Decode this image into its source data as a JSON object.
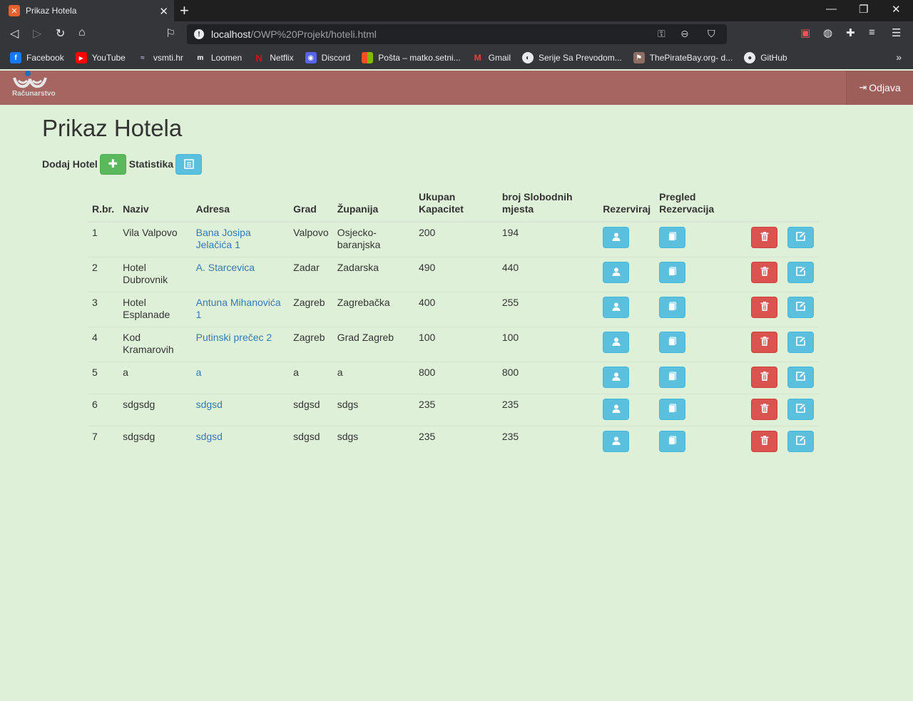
{
  "browser": {
    "tab_title": "Prikaz Hotela",
    "url_host": "localhost",
    "url_path": "/OWP%20Projekt/hoteli.html",
    "bookmarks": [
      {
        "label": "Facebook",
        "color": "#1877f2",
        "glyph": "f"
      },
      {
        "label": "YouTube",
        "color": "#ff0000",
        "glyph": "▶"
      },
      {
        "label": "vsmti.hr",
        "color": "#35363a",
        "glyph": "≈"
      },
      {
        "label": "Loomen",
        "color": "#35363a",
        "glyph": "m"
      },
      {
        "label": "Netflix",
        "color": "#35363a",
        "glyph": "N"
      },
      {
        "label": "Discord",
        "color": "#5865f2",
        "glyph": "◉"
      },
      {
        "label": "Pošta – matko.setni...",
        "color": "#f25022",
        "glyph": "▦"
      },
      {
        "label": "Gmail",
        "color": "#35363a",
        "glyph": "M"
      },
      {
        "label": "Serije Sa Prevodom...",
        "color": "#5f6368",
        "glyph": "◐"
      },
      {
        "label": "ThePirateBay.org- d...",
        "color": "#8d6e63",
        "glyph": "⚑"
      },
      {
        "label": "GitHub",
        "color": "#35363a",
        "glyph": "●"
      }
    ]
  },
  "header": {
    "logo_text": "Računarstvo",
    "logout_label": "Odjava"
  },
  "page": {
    "title": "Prikaz Hotela",
    "add_hotel_label": "Dodaj Hotel",
    "stats_label": "Statistika"
  },
  "table": {
    "headers": {
      "rbr": "R.br.",
      "naziv": "Naziv",
      "adresa": "Adresa",
      "grad": "Grad",
      "zupanija": "Županija",
      "kapacitet": "Ukupan Kapacitet",
      "slobodno": "broj Slobodnih mjesta",
      "rezerviraj": "Rezerviraj",
      "pregled": "Pregled Rezervacija"
    },
    "rows": [
      {
        "rbr": "1",
        "naziv": "Vila Valpovo",
        "adresa": "Bana Josipa Jelačića 1",
        "grad": "Valpovo",
        "zupanija": "Osjecko-baranjska",
        "kapacitet": "200",
        "slobodno": "194"
      },
      {
        "rbr": "2",
        "naziv": "Hotel Dubrovnik",
        "adresa": "A. Starcevica",
        "grad": "Zadar",
        "zupanija": "Zadarska",
        "kapacitet": "490",
        "slobodno": "440"
      },
      {
        "rbr": "3",
        "naziv": "Hotel Esplanade",
        "adresa": "Antuna Mihanovića 1",
        "grad": "Zagreb",
        "zupanija": "Zagrebačka",
        "kapacitet": "400",
        "slobodno": "255"
      },
      {
        "rbr": "4",
        "naziv": "Kod Kramarovih",
        "adresa": "Putinski prečec 2",
        "grad": "Zagreb",
        "zupanija": "Grad Zagreb",
        "kapacitet": "100",
        "slobodno": "100"
      },
      {
        "rbr": "5",
        "naziv": "a",
        "adresa": "a",
        "grad": "a",
        "zupanija": "a",
        "kapacitet": "800",
        "slobodno": "800"
      },
      {
        "rbr": "6",
        "naziv": "sdgsdg",
        "adresa": "sdgsd",
        "grad": "sdgsd",
        "zupanija": "sdgs",
        "kapacitet": "235",
        "slobodno": "235"
      },
      {
        "rbr": "7",
        "naziv": "sdgsdg",
        "adresa": "sdgsd",
        "grad": "sdgsd",
        "zupanija": "sdgs",
        "kapacitet": "235",
        "slobodno": "235"
      }
    ]
  },
  "colors": {
    "page_bg": "#dff0d8",
    "header_bg": "#a66560",
    "btn_success": "#5cb85c",
    "btn_info": "#5bc0de",
    "btn_danger": "#d9534f",
    "link": "#337ab7"
  },
  "icons": {
    "add": "plus-icon",
    "stats": "list-alt-icon",
    "reserve": "user-icon",
    "view_reservations": "book-icon",
    "delete": "trash-icon",
    "edit": "edit-icon",
    "logout": "log-out-icon"
  }
}
